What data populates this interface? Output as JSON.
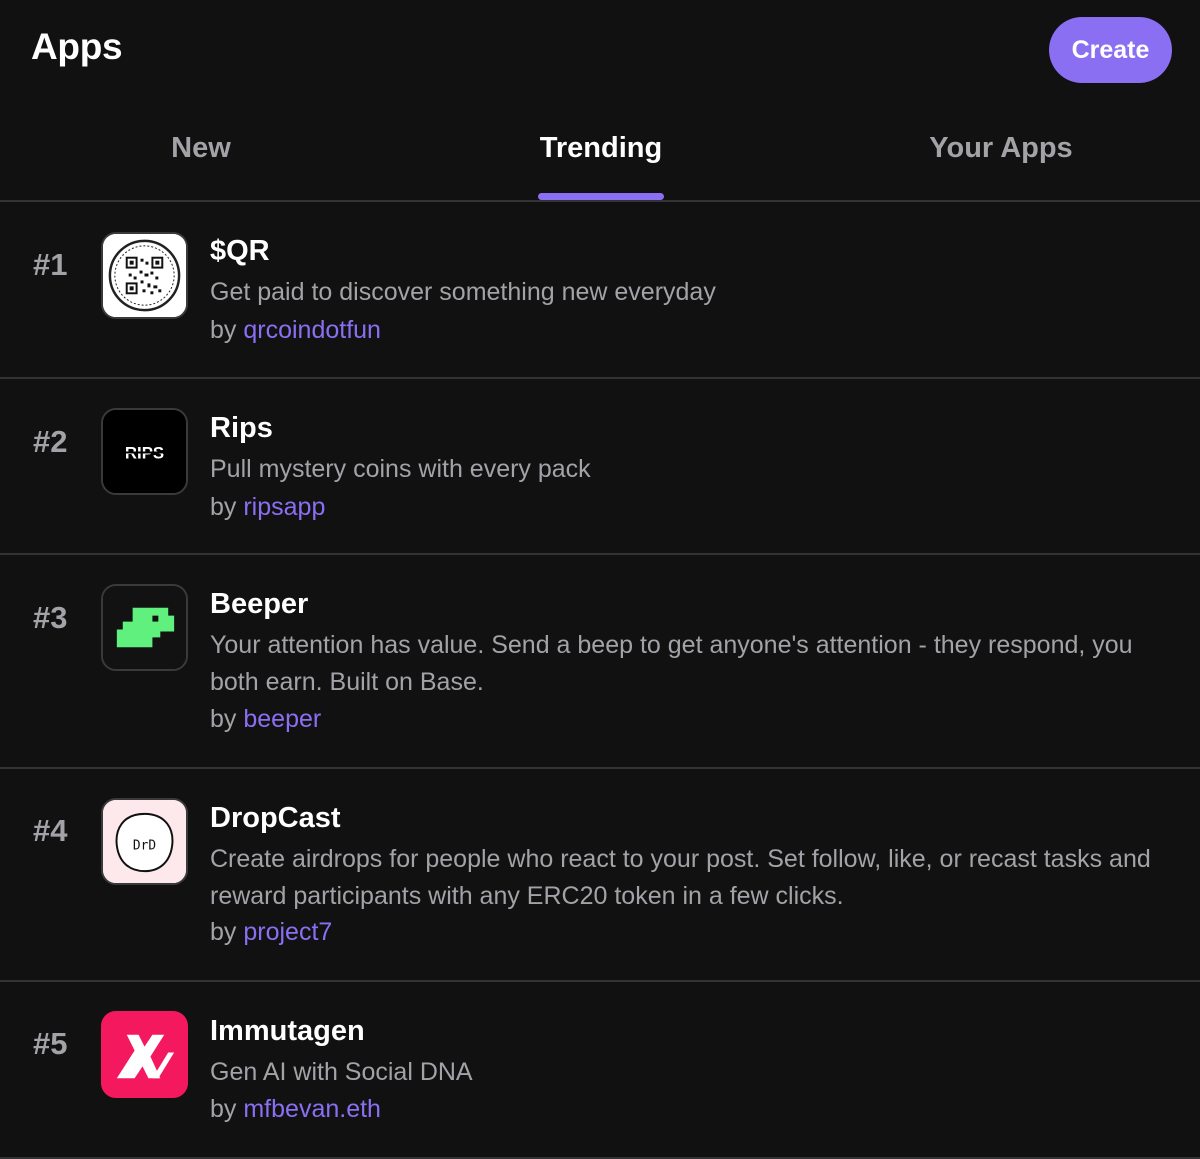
{
  "header": {
    "title": "Apps",
    "create_label": "Create"
  },
  "tabs": [
    {
      "label": "New",
      "active": false
    },
    {
      "label": "Trending",
      "active": true
    },
    {
      "label": "Your Apps",
      "active": false
    }
  ],
  "by_prefix": "by",
  "apps": [
    {
      "rank": "#1",
      "name": "$QR",
      "description": "Get paid to discover something new everyday",
      "author": "qrcoindotfun",
      "icon": "qr-code-icon"
    },
    {
      "rank": "#2",
      "name": "Rips",
      "description": "Pull mystery coins with every pack",
      "author": "ripsapp",
      "icon": "rips-logo-icon",
      "icon_text": "RIPS"
    },
    {
      "rank": "#3",
      "name": "Beeper",
      "description": "Your attention has value. Send a beep to get anyone's attention - they respond, you both earn. Built on Base.",
      "author": "beeper",
      "icon": "green-pixel-dino-icon"
    },
    {
      "rank": "#4",
      "name": "DropCast",
      "description": "Create airdrops for people who react to your post. Set follow, like, or recast tasks and reward participants with any ERC20 token in a few clicks.",
      "author": "project7",
      "icon": "drd-egg-face-icon",
      "icon_text": "DrD"
    },
    {
      "rank": "#5",
      "name": "Immutagen",
      "description": "Gen AI with Social DNA",
      "author": "mfbevan.eth",
      "icon": "immutagen-logo-icon"
    }
  ],
  "colors": {
    "background": "#111112",
    "accent": "#8b6ff2",
    "muted_text": "#a2a2a7",
    "divider": "#333336",
    "beeper_green": "#5ff07e",
    "immutagen_pink": "#f4195f"
  }
}
